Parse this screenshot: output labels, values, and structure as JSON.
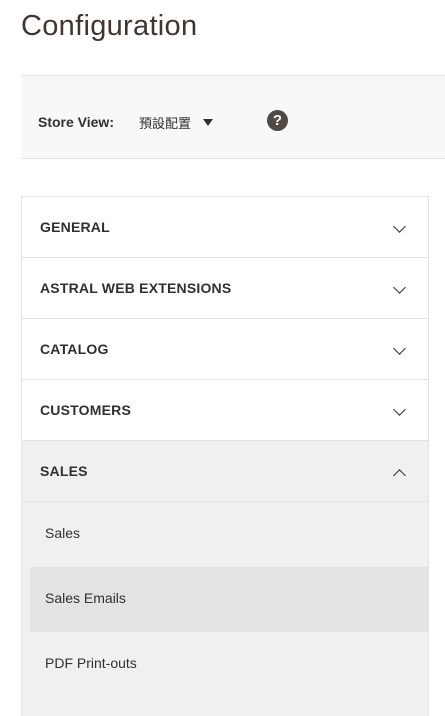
{
  "page": {
    "title": "Configuration"
  },
  "store_view": {
    "label": "Store View:",
    "selected": "預設配置",
    "help_icon": "question-circle-icon",
    "help_glyph": "?"
  },
  "tabs": [
    {
      "label": "GENERAL",
      "expanded": false,
      "icon": "chevron-down-icon"
    },
    {
      "label": "ASTRAL WEB EXTENSIONS",
      "expanded": false,
      "icon": "chevron-down-icon"
    },
    {
      "label": "CATALOG",
      "expanded": false,
      "icon": "chevron-down-icon"
    },
    {
      "label": "CUSTOMERS",
      "expanded": false,
      "icon": "chevron-down-icon"
    },
    {
      "label": "SALES",
      "expanded": true,
      "icon": "chevron-up-icon"
    }
  ],
  "sales_items": [
    {
      "label": "Sales",
      "active": false
    },
    {
      "label": "Sales Emails",
      "active": true
    },
    {
      "label": "PDF Print-outs",
      "active": false
    }
  ],
  "colors": {
    "title": "#41362f",
    "tab_border": "#e3e3e3",
    "open_tab_background": "#f0f0f0",
    "active_item_background": "#e3e3e3",
    "help_icon_background": "#514943"
  }
}
